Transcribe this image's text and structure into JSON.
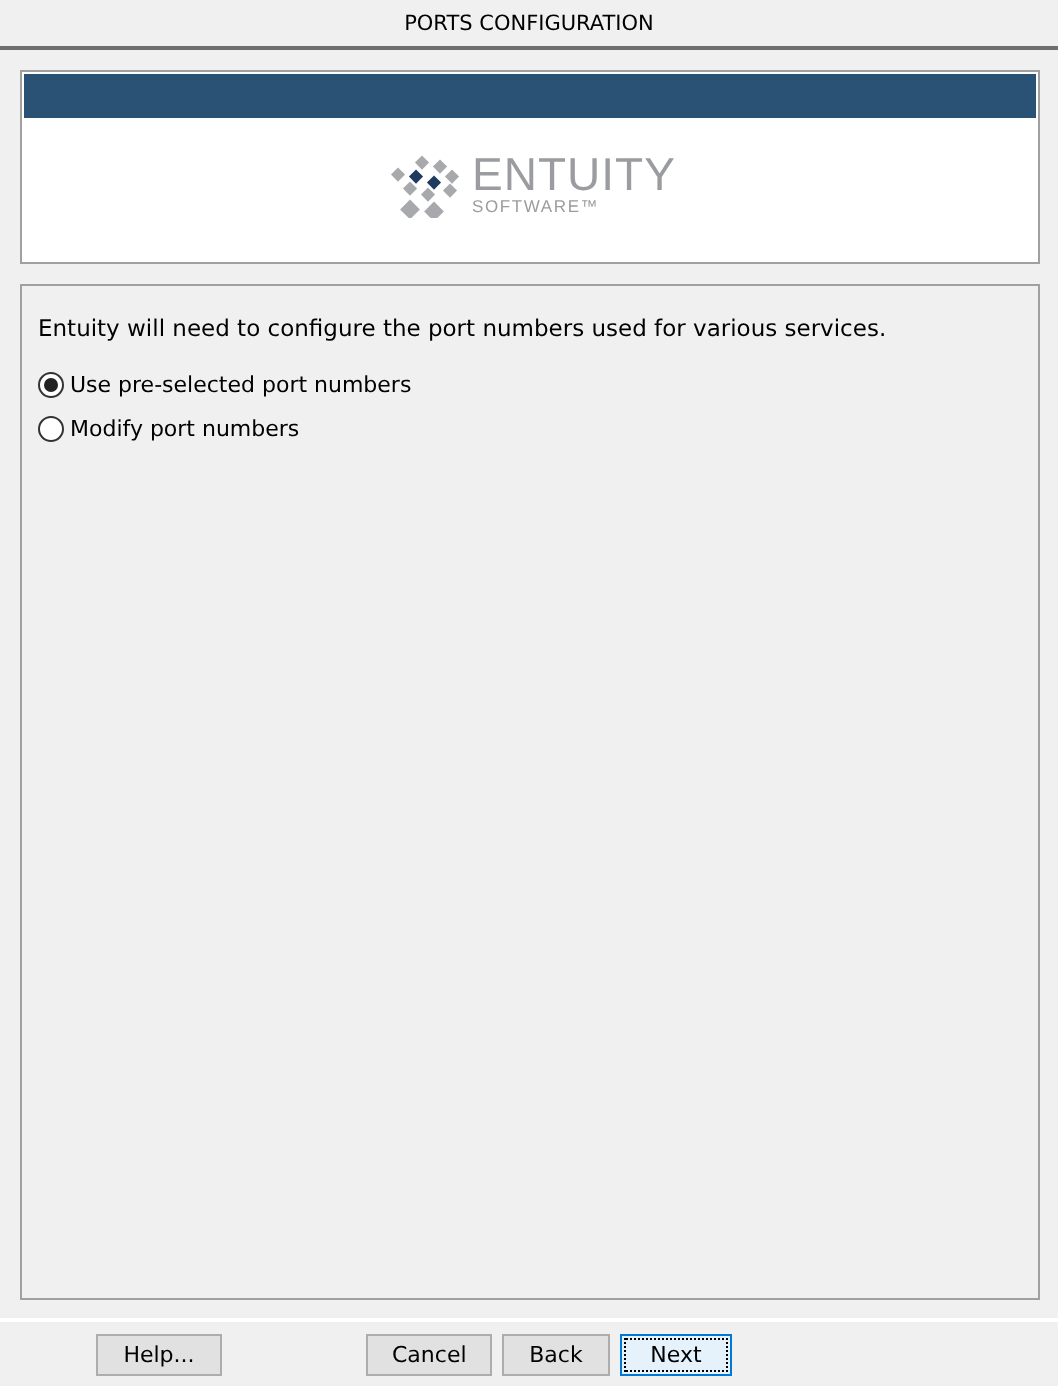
{
  "window": {
    "title": "PORTS CONFIGURATION"
  },
  "logo": {
    "name": "ENTUITY",
    "tagline": "SOFTWARE™"
  },
  "intro": "Entuity will need to configure the port numbers used for various services.",
  "options": [
    {
      "label": "Use pre-selected port numbers",
      "selected": true
    },
    {
      "label": "Modify port numbers",
      "selected": false
    }
  ],
  "help_button": {
    "label": "Help...",
    "focused": false
  },
  "buttons": [
    {
      "label": "Cancel",
      "focused": false
    },
    {
      "label": "Back",
      "focused": false
    },
    {
      "label": "Next",
      "focused": true
    }
  ]
}
